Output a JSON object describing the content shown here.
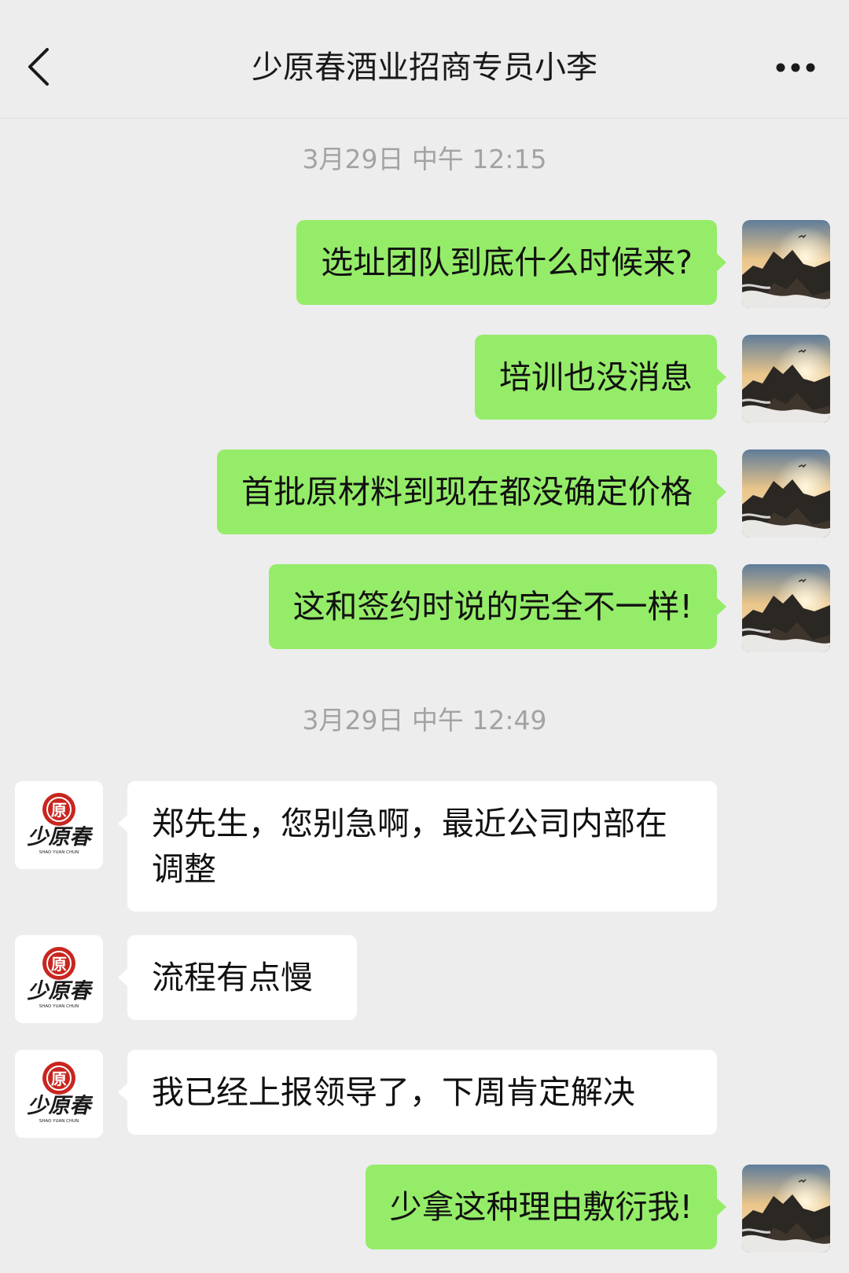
{
  "header": {
    "title": "少原春酒业招商专员小李",
    "back_icon": "chevron-left-icon",
    "more_icon": "more-dots-icon"
  },
  "logo": {
    "main": "少原春",
    "sub": "SHAO YUAN CHUN",
    "seal": "原"
  },
  "timestamps": [
    "3月29日 中午 12:15",
    "3月29日 中午 12:49"
  ],
  "messages": [
    {
      "side": "me",
      "text": "选址团队到底什么时候来?"
    },
    {
      "side": "me",
      "text": "培训也没消息"
    },
    {
      "side": "me",
      "text": "首批原材料到现在都没确定价格"
    },
    {
      "side": "me",
      "text": "这和签约时说的完全不一样!"
    },
    {
      "side": "them",
      "text": "郑先生，您别急啊，最近公司内部在调整"
    },
    {
      "side": "them",
      "text": "流程有点慢"
    },
    {
      "side": "them",
      "text": "我已经上报领导了，下周肯定解决"
    },
    {
      "side": "me",
      "text": "少拿这种理由敷衍我!"
    }
  ],
  "colors": {
    "my_bubble": "#95ec69",
    "their_bubble": "#ffffff",
    "background": "#ededed",
    "timestamp": "#a3a3a3"
  }
}
